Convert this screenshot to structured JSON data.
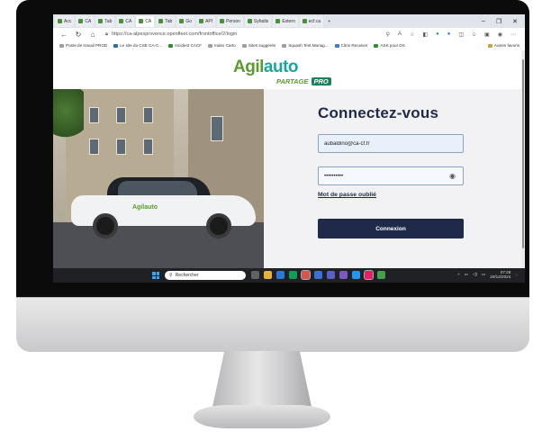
{
  "browser": {
    "tabs": [
      {
        "label": "Acc"
      },
      {
        "label": "CA"
      },
      {
        "label": "Tab"
      },
      {
        "label": "CA"
      },
      {
        "label": "CA",
        "active": true
      },
      {
        "label": "Tab"
      },
      {
        "label": "Go"
      },
      {
        "label": "API"
      },
      {
        "label": "Person"
      },
      {
        "label": "Syfadis"
      },
      {
        "label": "Extern"
      },
      {
        "label": "ecf.ca"
      }
    ],
    "new_tab": "+",
    "window_controls": {
      "minimize": "–",
      "maximize": "❐",
      "close": "✕"
    },
    "url": "https://ca-alpesprovence.openfleet.com/frontoffice/2/login",
    "bookmarks": [
      "Poste de travail PROD",
      "Le site du CSE CA-C...",
      "Incident CACF",
      "Index Carto",
      "Sites suggérés",
      "Squash Test Manag...",
      "Citrix Receiver",
      "ASK pour DS"
    ],
    "bookmarks_more": "Autres favoris"
  },
  "page": {
    "logo": {
      "main_1": "Agil",
      "main_2": "auto",
      "sub": "PARTAGE",
      "pro": "PRO"
    },
    "photo_car_logo": "Agilauto",
    "login": {
      "title": "Connectez-vous",
      "email_value": "aubaldino@ca-cf.fr",
      "password_value": "••••••••••",
      "forgot_label": "Mot de passe oublié",
      "submit_label": "Connexion"
    }
  },
  "taskbar": {
    "search_placeholder": "Rechercher",
    "time": "07:28",
    "date": "20/12/2024"
  },
  "colors": {
    "brand_green": "#5b9a32",
    "brand_teal": "#1aa6a0",
    "navy": "#1f2a4a"
  }
}
